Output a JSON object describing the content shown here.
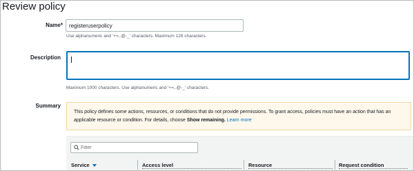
{
  "page": {
    "title": "Review policy"
  },
  "name_field": {
    "label": "Name",
    "required_mark": "*",
    "value": "registeruserpolicy",
    "hint": "Use alphanumeric and '+=,.@-_' characters. Maximum 128 characters."
  },
  "description_field": {
    "label": "Description",
    "value": "",
    "hint": "Maximum 1000 characters. Use alphanumeric and '+=,.@-_' characters."
  },
  "summary": {
    "label": "Summary",
    "alert": {
      "text_before": "This policy defines some actions, resources, or conditions that do not provide permissions. To grant access, policies must have an action that has an applicable resource or condition. For details, choose ",
      "bold_text": "Show remaining.",
      "link_text": "Learn more"
    },
    "filter": {
      "placeholder": "Filter",
      "icon": "search-icon"
    },
    "columns": [
      "Service",
      "Access level",
      "Resource",
      "Request condition"
    ],
    "sort_icon": "caret-down-icon",
    "colors": {
      "alert_background": "#fef8ec",
      "alert_border": "#f7d79c",
      "link": "#0073bb",
      "focus_border": "#0073bb"
    }
  }
}
